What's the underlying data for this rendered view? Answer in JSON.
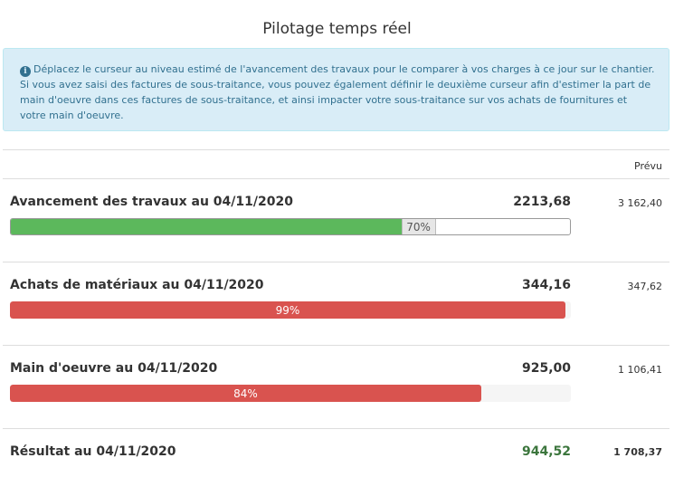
{
  "page": {
    "title": "Pilotage temps réel"
  },
  "info": {
    "icon": "info-icon",
    "text": "Déplacez le curseur au niveau estimé de l'avancement des travaux pour le comparer à vos charges à ce jour sur le chantier. Si vous avez saisi des factures de sous-traitance, vous pouvez également définir le deuxième curseur afin d'estimer la part de main d'oeuvre dans ces factures de sous-traitance, et ainsi impacter votre sous-traitance sur vos achats de fournitures et votre main d'oeuvre."
  },
  "table": {
    "prevu_header": "Prévu",
    "rows": [
      {
        "label": "Avancement des travaux au 04/11/2020",
        "value": "2213,68",
        "prevu": "3 162,40",
        "percent": 70,
        "percent_label": "70%",
        "bar_color": "#5cb85c"
      },
      {
        "label": "Achats de matériaux au 04/11/2020",
        "value": "344,16",
        "prevu": "347,62",
        "percent": 99,
        "percent_label": "99%",
        "bar_color": "#d9534f"
      },
      {
        "label": "Main d'oeuvre au 04/11/2020",
        "value": "925,00",
        "prevu": "1 106,41",
        "percent": 84,
        "percent_label": "84%",
        "bar_color": "#d9534f"
      }
    ],
    "result": {
      "label": "Résultat au 04/11/2020",
      "value": "944,52",
      "prevu": "1 708,37",
      "value_color": "#3c763d"
    }
  }
}
